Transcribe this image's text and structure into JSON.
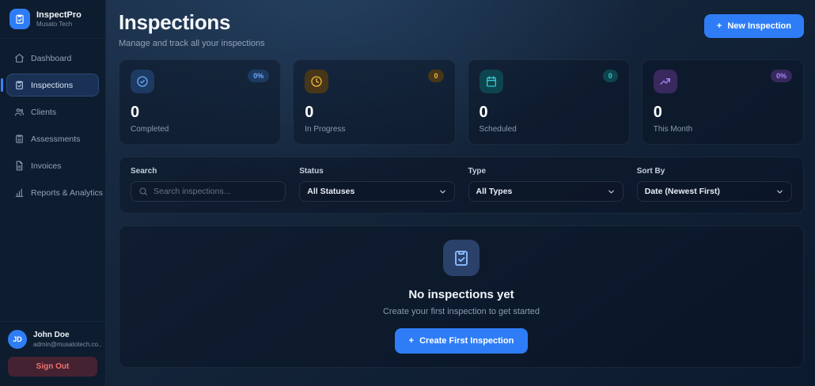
{
  "brand": {
    "name": "InspectPro",
    "company": "Musato Tech"
  },
  "sidebar": {
    "items": [
      {
        "label": "Dashboard"
      },
      {
        "label": "Inspections"
      },
      {
        "label": "Clients"
      },
      {
        "label": "Assessments"
      },
      {
        "label": "Invoices"
      },
      {
        "label": "Reports & Analytics"
      }
    ],
    "user": {
      "initials": "JD",
      "name": "John Doe",
      "email": "admin@musatotech.co..."
    },
    "sign_out_label": "Sign Out"
  },
  "header": {
    "title": "Inspections",
    "subtitle": "Manage and track all your inspections",
    "new_button_label": "New Inspection",
    "plus": "+"
  },
  "stats": [
    {
      "value": "0",
      "label": "Completed",
      "badge": "0%",
      "accent": "#6ea8f8",
      "tile_bg": "#1d3a63"
    },
    {
      "value": "0",
      "label": "In Progress",
      "badge": "0",
      "accent": "#f5b63f",
      "tile_bg": "#473618"
    },
    {
      "value": "0",
      "label": "Scheduled",
      "badge": "0",
      "accent": "#35c9d4",
      "tile_bg": "#0e444e"
    },
    {
      "value": "0",
      "label": "This Month",
      "badge": "0%",
      "accent": "#a685f2",
      "tile_bg": "#37295e"
    }
  ],
  "filters": {
    "search": {
      "label": "Search",
      "placeholder": "Search inspections..."
    },
    "status": {
      "label": "Status",
      "value": "All Statuses"
    },
    "type": {
      "label": "Type",
      "value": "All Types"
    },
    "sort": {
      "label": "Sort By",
      "value": "Date (Newest First)"
    }
  },
  "empty_state": {
    "title": "No inspections yet",
    "subtitle": "Create your first inspection to get started",
    "button_label": "Create First Inspection",
    "plus": "+"
  },
  "colors": {
    "accent_blue": "#2e7df6",
    "background": "#0c1a2e",
    "sidebar_bg": "#0e1c2f",
    "signout_bg": "#452231",
    "signout_text": "#ef7272"
  }
}
